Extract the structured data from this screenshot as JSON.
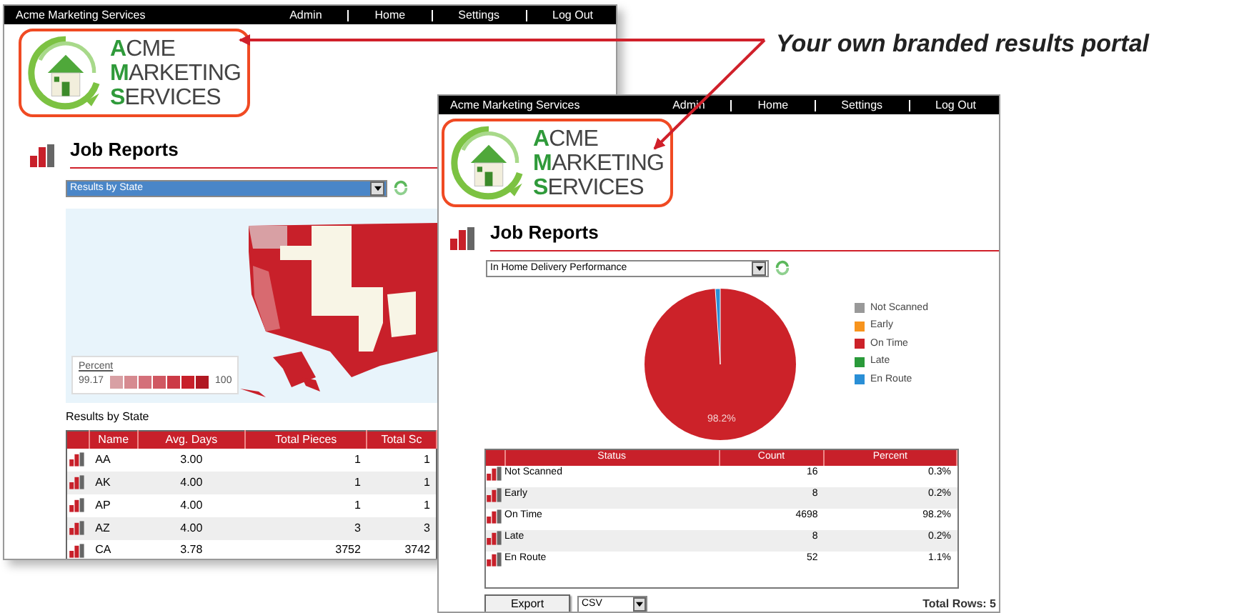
{
  "callout": {
    "text": "Your own branded results portal"
  },
  "windows": [
    {
      "top_bar": {
        "title": "Acme Marketing Services",
        "links": [
          "Admin",
          "Home",
          "Settings",
          "Log Out"
        ]
      },
      "logo": {
        "lines": [
          "ACME",
          "MARKETING",
          "SERVICES"
        ]
      },
      "heading": "Job Reports",
      "report_select": {
        "value": "Results by State",
        "highlighted": true
      },
      "map": {
        "legend_title": "Percent",
        "legend_min": "99.17",
        "legend_max": "100"
      },
      "table_title": "Results by State",
      "table": {
        "columns": [
          "Name",
          "Avg. Days",
          "Total Pieces",
          "Total Sc"
        ],
        "rows": [
          [
            "AA",
            "3.00",
            "1",
            "1"
          ],
          [
            "AK",
            "4.00",
            "1",
            "1"
          ],
          [
            "AP",
            "4.00",
            "1",
            "1"
          ],
          [
            "AZ",
            "4.00",
            "3",
            "3"
          ],
          [
            "CA",
            "3.78",
            "3752",
            "3742"
          ]
        ]
      }
    },
    {
      "top_bar": {
        "title": "Acme Marketing Services",
        "links": [
          "Admin",
          "Home",
          "Settings",
          "Log Out"
        ]
      },
      "logo": {
        "lines": [
          "ACME",
          "MARKETING",
          "SERVICES"
        ]
      },
      "heading": "Job Reports",
      "report_select": {
        "value": "In Home Delivery Performance",
        "highlighted": false
      },
      "slice_label": "98.2%",
      "legend": [
        {
          "label": "Not Scanned",
          "color": "#999999"
        },
        {
          "label": "Early",
          "color": "#f7941d"
        },
        {
          "label": "On Time",
          "color": "#cc2229"
        },
        {
          "label": "Late",
          "color": "#2a9a3a"
        },
        {
          "label": "En Route",
          "color": "#2a8fd6"
        }
      ],
      "table": {
        "columns": [
          "Status",
          "Count",
          "Percent"
        ],
        "rows": [
          [
            "Not Scanned",
            "16",
            "0.3%"
          ],
          [
            "Early",
            "8",
            "0.2%"
          ],
          [
            "On Time",
            "4698",
            "98.2%"
          ],
          [
            "Late",
            "8",
            "0.2%"
          ],
          [
            "En Route",
            "52",
            "1.1%"
          ]
        ]
      },
      "export_button": "Export",
      "format_select": {
        "value": "CSV"
      },
      "total_rows": "Total Rows: 5"
    }
  ]
}
